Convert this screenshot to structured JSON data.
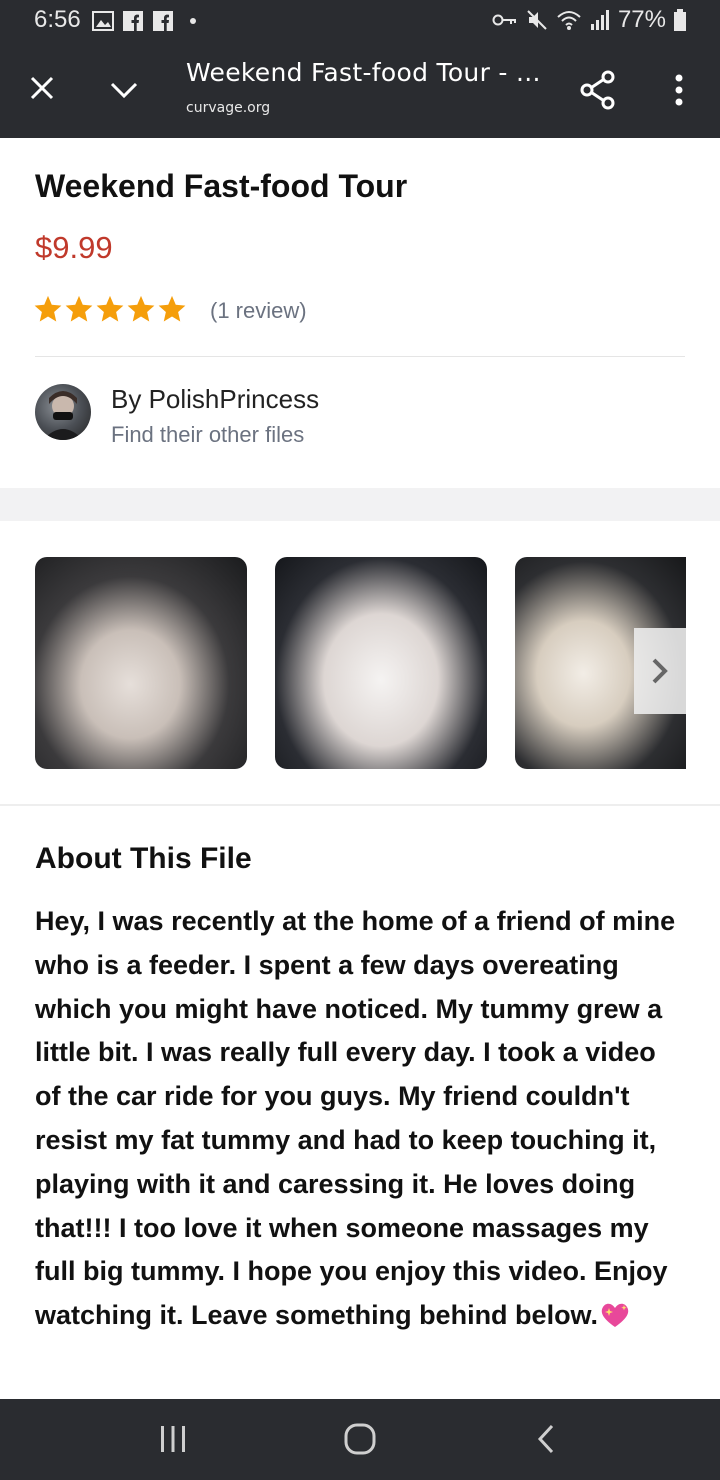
{
  "status_bar": {
    "time": "6:56",
    "battery": "77%",
    "left_icons": [
      "gallery-icon",
      "facebook-icon",
      "facebook-icon",
      "dot-icon"
    ],
    "right_icons": [
      "vpn-key-icon",
      "mute-icon",
      "wifi-icon",
      "signal-icon",
      "battery-icon"
    ]
  },
  "browser": {
    "title": "Weekend Fast-food Tour - ...",
    "url": "curvage.org"
  },
  "product": {
    "title": "Weekend Fast-food Tour",
    "price": "$9.99",
    "rating": 5,
    "review_count": "(1 review)",
    "author": "By PolishPrincess",
    "author_link": "Find their other files",
    "star_color": "#f59e0b",
    "price_color": "#c0392b"
  },
  "gallery": {
    "thumbnails": [
      "photo-1",
      "photo-2",
      "photo-3"
    ]
  },
  "about": {
    "title": "About This File",
    "body": "Hey, I was recently at the home of a friend of mine who is a feeder. I spent a few days overeating which you might have noticed. My tummy grew a little bit. I was really full every day. I took a video of the car ride for you guys. My friend couldn't resist my fat tummy and had to keep touching it, playing with it and caressing it. He loves doing that!!! I too love it when someone massages my full big tummy. I hope you enjoy this video. Enjoy watching it. Leave something behind below."
  },
  "nav": {
    "buttons": [
      "recents",
      "home",
      "back"
    ]
  }
}
